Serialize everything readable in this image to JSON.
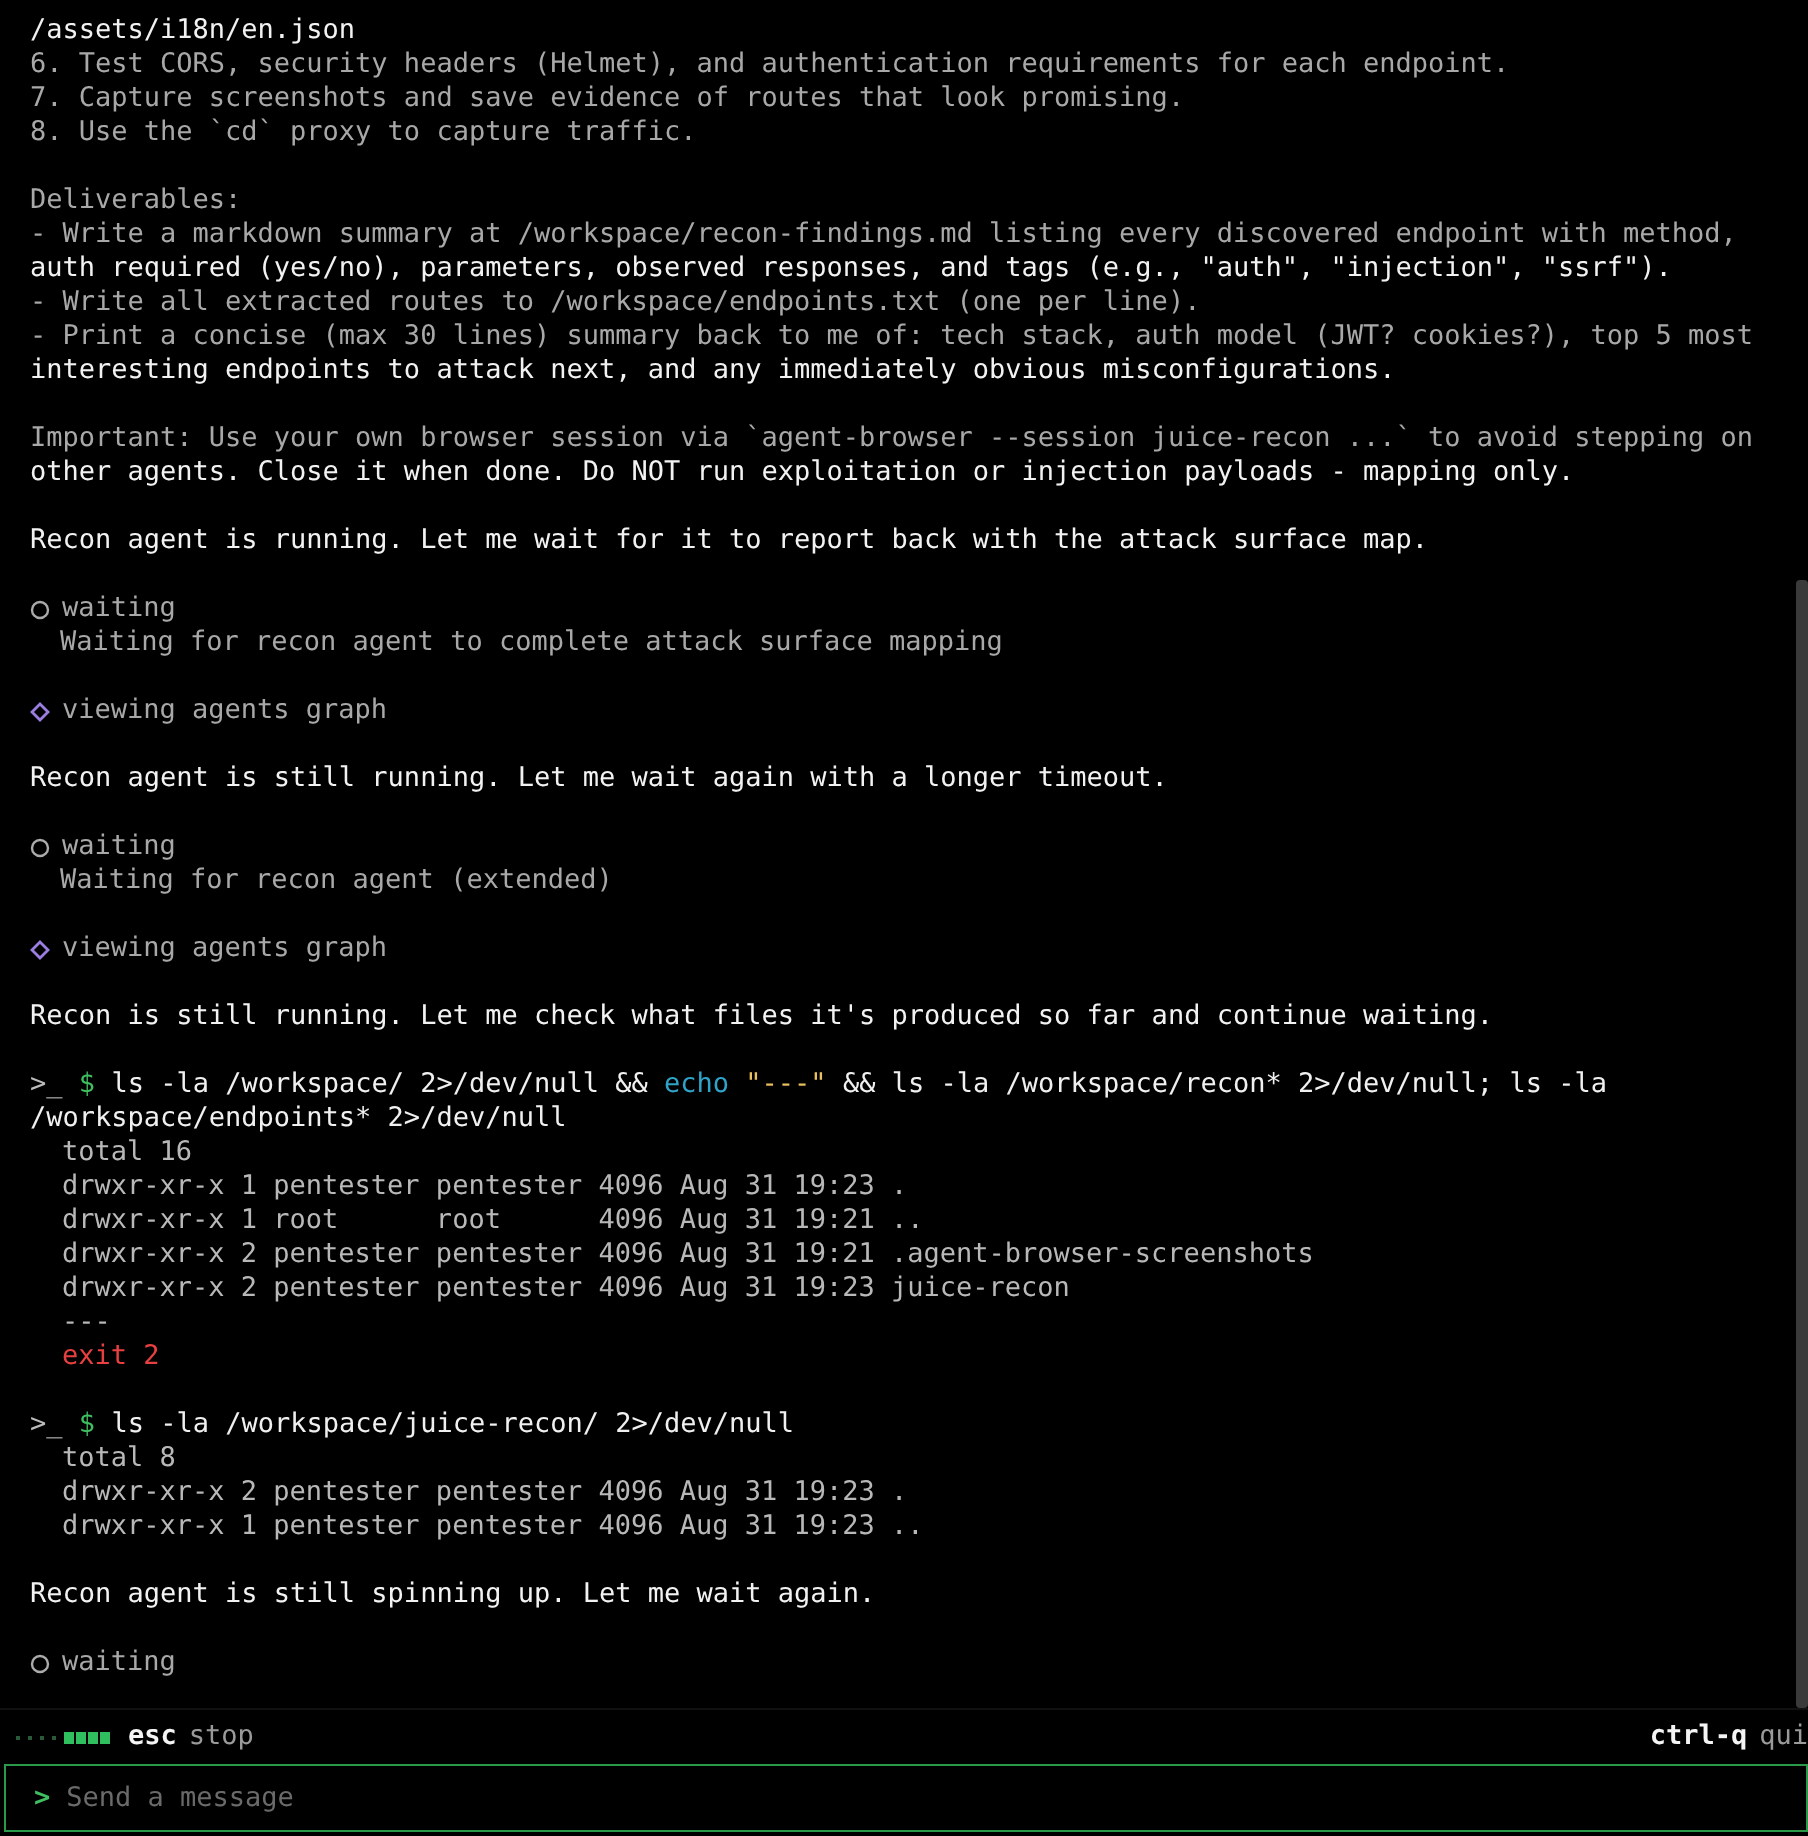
{
  "transcript": [
    {
      "kind": "text",
      "lines": [
        {
          "text": "/assets/i18n/en.json",
          "bright": true
        },
        {
          "text": "6. Test CORS, security headers (Helmet), and authentication requirements for each endpoint.",
          "bright": false
        },
        {
          "text": "7. Capture screenshots and save evidence of routes that look promising.",
          "bright": false
        },
        {
          "text": "8. Use the `cd` proxy to capture traffic.",
          "bright": false
        }
      ]
    },
    {
      "kind": "text",
      "lines": [
        {
          "text": "Deliverables:",
          "bright": false
        },
        {
          "text": "- Write a markdown summary at /workspace/recon-findings.md listing every discovered endpoint with method,",
          "bright": false
        },
        {
          "text": "auth required (yes/no), parameters, observed responses, and tags (e.g., \"auth\", \"injection\", \"ssrf\").",
          "bright": true
        },
        {
          "text": "- Write all extracted routes to /workspace/endpoints.txt (one per line).",
          "bright": false
        },
        {
          "text": "- Print a concise (max 30 lines) summary back to me of: tech stack, auth model (JWT? cookies?), top 5 most",
          "bright": false
        },
        {
          "text": "interesting endpoints to attack next, and any immediately obvious misconfigurations.",
          "bright": true
        }
      ]
    },
    {
      "kind": "text",
      "lines": [
        {
          "text": "Important: Use your own browser session via `agent-browser --session juice-recon ...` to avoid stepping on",
          "bright": false
        },
        {
          "text": "other agents. Close it when done. Do NOT run exploitation or injection payloads - mapping only.",
          "bright": true
        }
      ]
    },
    {
      "kind": "text",
      "lines": [
        {
          "text": "Recon agent is running. Let me wait for it to report back with the attack surface map.",
          "bright": true
        }
      ]
    },
    {
      "kind": "wait",
      "title": "waiting",
      "detail": "Waiting for recon agent to complete attack surface mapping"
    },
    {
      "kind": "graph",
      "title": "viewing agents graph"
    },
    {
      "kind": "text",
      "lines": [
        {
          "text": "Recon agent is still running. Let me wait again with a longer timeout.",
          "bright": true
        }
      ]
    },
    {
      "kind": "wait",
      "title": "waiting",
      "detail": "Waiting for recon agent (extended)"
    },
    {
      "kind": "graph",
      "title": "viewing agents graph"
    },
    {
      "kind": "text",
      "lines": [
        {
          "text": "Recon is still running. Let me check what files it's produced so far and continue waiting.",
          "bright": true
        }
      ]
    },
    {
      "kind": "command",
      "prompt": ">_",
      "sign": "$",
      "parts": [
        {
          "kind": "plain",
          "text": "ls -la /workspace/ 2>/dev/null && "
        },
        {
          "kind": "keyword",
          "text": "echo"
        },
        {
          "kind": "string",
          "text": " \"---\""
        },
        {
          "kind": "plain",
          "text": " && ls -la /workspace/recon* 2>/dev/null; ls -la /workspace/endpoints* 2>/dev/null"
        }
      ],
      "output": [
        "total 16",
        "drwxr-xr-x 1 pentester pentester 4096 Aug 31 19:23 .",
        "drwxr-xr-x 1 root      root      4096 Aug 31 19:21 ..",
        "drwxr-xr-x 2 pentester pentester 4096 Aug 31 19:21 .agent-browser-screenshots",
        "drwxr-xr-x 2 pentester pentester 4096 Aug 31 19:23 juice-recon",
        "---"
      ],
      "exit": "exit 2"
    },
    {
      "kind": "command",
      "prompt": ">_",
      "sign": "$",
      "parts": [
        {
          "kind": "plain",
          "text": "ls -la /workspace/juice-recon/ 2>/dev/null"
        }
      ],
      "output": [
        "total 8",
        "drwxr-xr-x 2 pentester pentester 4096 Aug 31 19:23 .",
        "drwxr-xr-x 1 pentester pentester 4096 Aug 31 19:23 .."
      ]
    },
    {
      "kind": "text",
      "lines": [
        {
          "text": "Recon agent is still spinning up. Let me wait again.",
          "bright": true
        }
      ]
    },
    {
      "kind": "wait",
      "title": "waiting"
    }
  ],
  "status_bar": {
    "key": "esc",
    "action": "stop",
    "right_key": "ctrl-q",
    "right_action": "qui"
  },
  "input": {
    "prompt": ">",
    "placeholder": "Send a message"
  }
}
